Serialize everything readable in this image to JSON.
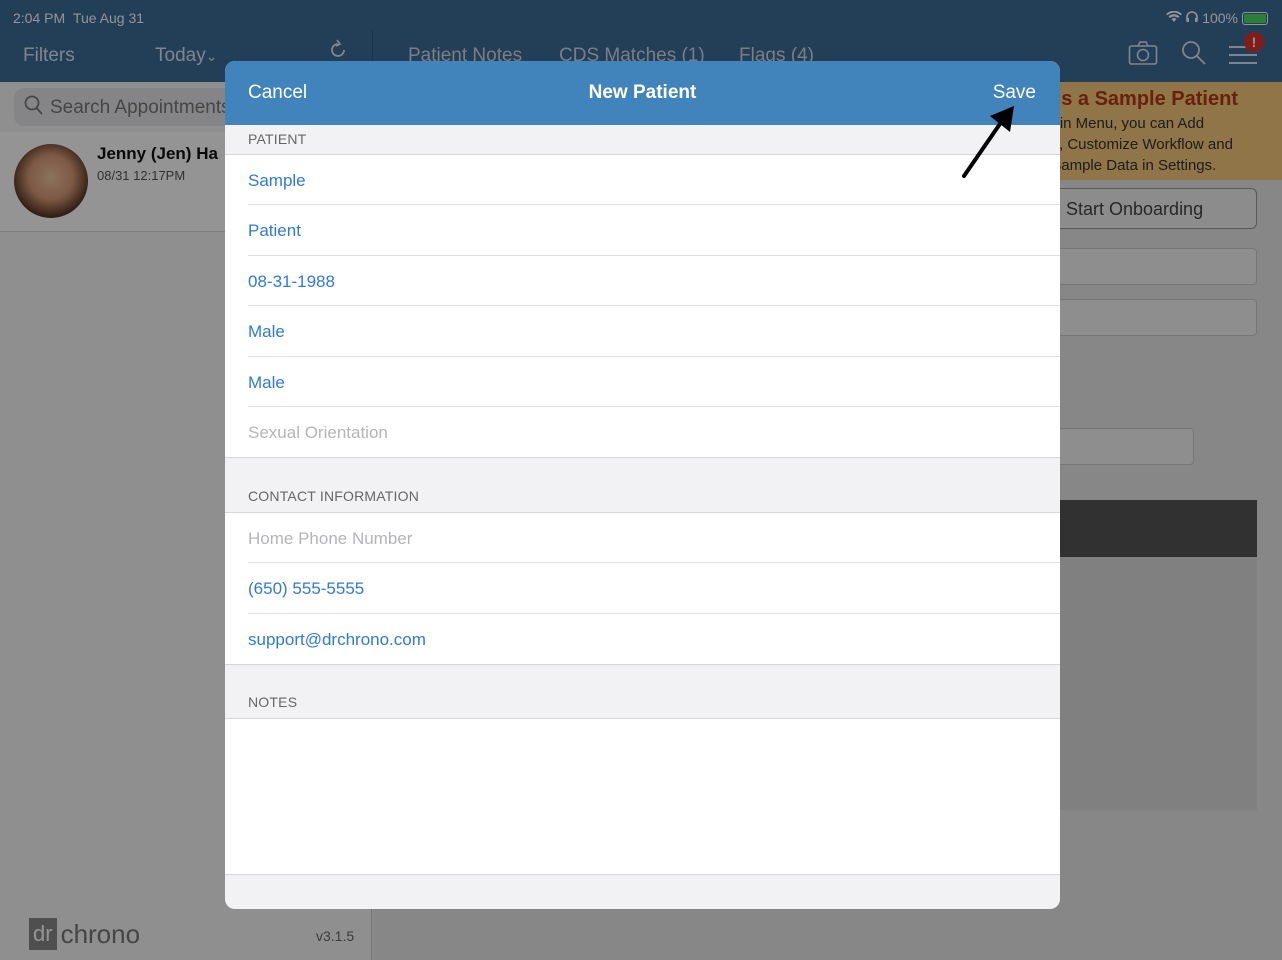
{
  "status_bar": {
    "time": "2:04 PM",
    "date": "Tue Aug 31",
    "battery": "100%"
  },
  "left_header": {
    "filters": "Filters",
    "today": "Today",
    "today_chevron": "⌄"
  },
  "right_header": {
    "tabs": [
      "Patient Notes",
      "CDS Matches (1)",
      "Flags (4)"
    ],
    "alert_count": "!"
  },
  "left_pane": {
    "search_placeholder": "Search Appointments",
    "appointment": {
      "name": "Jenny (Jen) Ha",
      "time": "08/31 12:17PM"
    },
    "logo_dr": "dr",
    "logo_chrono": "chrono",
    "version": "v3.1.5"
  },
  "banner": {
    "title": "s is a Sample Patient",
    "line1": "Main Menu, you can Add",
    "line2": "nts, Customize Workflow and",
    "line3": "ff Sample Data in Settings."
  },
  "onboarding_button": "Start Onboarding",
  "modal": {
    "cancel": "Cancel",
    "title": "New Patient",
    "save": "Save",
    "patient_section": "PATIENT",
    "patient_fields": [
      "Sample",
      "Patient",
      "08-31-1988",
      "Male",
      "Male",
      "Sexual Orientation"
    ],
    "contact_section": "CONTACT INFORMATION",
    "contact_fields": [
      "Home Phone Number",
      "(650) 555-5555",
      "support@drchrono.com"
    ],
    "notes_section": "NOTES"
  }
}
